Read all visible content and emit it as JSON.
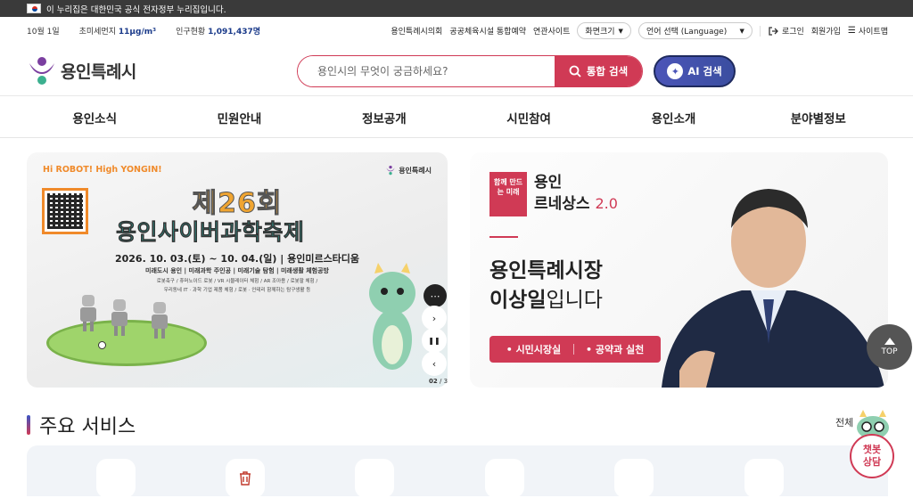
{
  "topbar": {
    "notice": "이 누리집은 대한민국 공식 전자정부 누리집입니다."
  },
  "util": {
    "date": "10월 1일",
    "dust_label": "초미세먼지",
    "dust_value": "11μg/m³",
    "pop_label": "인구현황",
    "pop_value": "1,091,437명",
    "links": [
      "용인특례시의회",
      "공공체육시설 통합예약",
      "연관사이트"
    ],
    "font_size": "화면크기",
    "language": "언어 선택 (Language)",
    "login": "로그인",
    "join": "회원가입",
    "sitemap": "사이트맵"
  },
  "header": {
    "logo_text": "용인특례시",
    "search_placeholder": "용인시의 무엇이 궁금하세요?",
    "search_button": "통합 검색",
    "ai_button": "AI 검색"
  },
  "gnb": [
    "용인소식",
    "민원안내",
    "정보공개",
    "시민참여",
    "용인소개",
    "분야별정보"
  ],
  "banner1": {
    "hi_robot": "Hi ROBOT!",
    "high_yongin": "High YONGIN!",
    "logo_text": "용인특례시",
    "title_line1": "제26회",
    "title_line2": "용인사이버과학축제",
    "date": "2026. 10. 03.(토) ~ 10. 04.(일) | 용인미르스타디움",
    "sub": "미래도시 용인 | 미래과학 주인공 | 미래기술 탐험 | 미래생활 체험공방",
    "sub2a": "로봇축구 / 휴머노이드 로봇 / VR 시뮬레이터 체험 / AR 조아용 / 로봇팔 체험 /",
    "sub2b": "우리동네 IT · 과학 기업 제품 체험 / 로봇 · 인테리 함께하는 탐구생활 등",
    "pager_current": "02",
    "pager_total": "/ 3"
  },
  "banner2": {
    "badge": "함께 만드는 미래",
    "ren_line1": "용인",
    "ren_line2": "르네상스",
    "ren_version": "2.0",
    "mayor_line1": "용인특례시장",
    "mayor_name": "이상일",
    "mayor_suffix": "입니다",
    "link1": "시민시장실",
    "link2": "공약과 실천"
  },
  "top_button": "TOP",
  "services": {
    "title": "주요 서비스",
    "all": "전체"
  },
  "chatbot": {
    "line1": "챗봇",
    "line2": "상담"
  },
  "colors": {
    "accent": "#d03a55",
    "navy": "#1a3a8a",
    "ai": "#4b55b8"
  }
}
